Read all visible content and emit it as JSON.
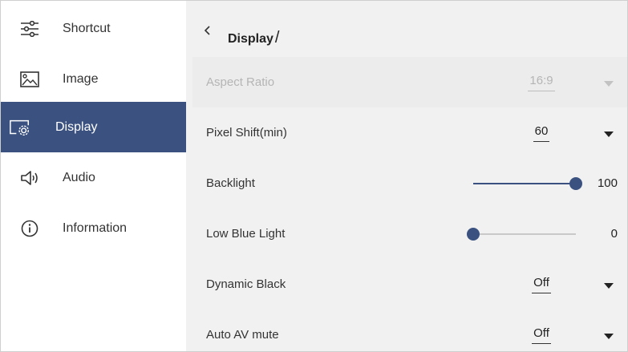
{
  "sidebar": {
    "items": [
      {
        "label": "Shortcut",
        "icon": "sliders-icon"
      },
      {
        "label": "Image",
        "icon": "image-icon"
      },
      {
        "label": "Display",
        "icon": "display-settings-icon",
        "active": true
      },
      {
        "label": "Audio",
        "icon": "speaker-icon"
      },
      {
        "label": "Information",
        "icon": "info-icon"
      }
    ]
  },
  "header": {
    "title": "Display",
    "separator": "/"
  },
  "settings": {
    "aspect_ratio": {
      "label": "Aspect Ratio",
      "value": "16:9",
      "disabled": true
    },
    "pixel_shift": {
      "label": "Pixel Shift(min)",
      "value": "60"
    },
    "backlight": {
      "label": "Backlight",
      "value": "100",
      "fraction": 1.0
    },
    "low_blue_light": {
      "label": "Low Blue Light",
      "value": "0",
      "fraction": 0.0
    },
    "dynamic_black": {
      "label": "Dynamic Black",
      "value": "Off"
    },
    "auto_av_mute": {
      "label": "Auto AV mute",
      "value": "Off"
    }
  },
  "colors": {
    "accent": "#3b5281",
    "panel_bg": "#f1f1f1",
    "disabled_text": "#b5b5b5"
  }
}
